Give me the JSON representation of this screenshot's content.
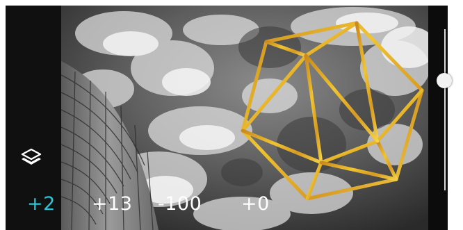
{
  "toolbar": {
    "layers_icon": "layers-icon"
  },
  "adjustments": [
    {
      "label": "+2",
      "active": true
    },
    {
      "label": "+13",
      "active": false
    },
    {
      "label": "-100",
      "active": false
    },
    {
      "label": "+0",
      "active": false
    }
  ],
  "slider": {
    "level_fraction": 0.32
  },
  "colors": {
    "accent": "#2ec4d6",
    "overlay_gold": "#e2b02a"
  }
}
